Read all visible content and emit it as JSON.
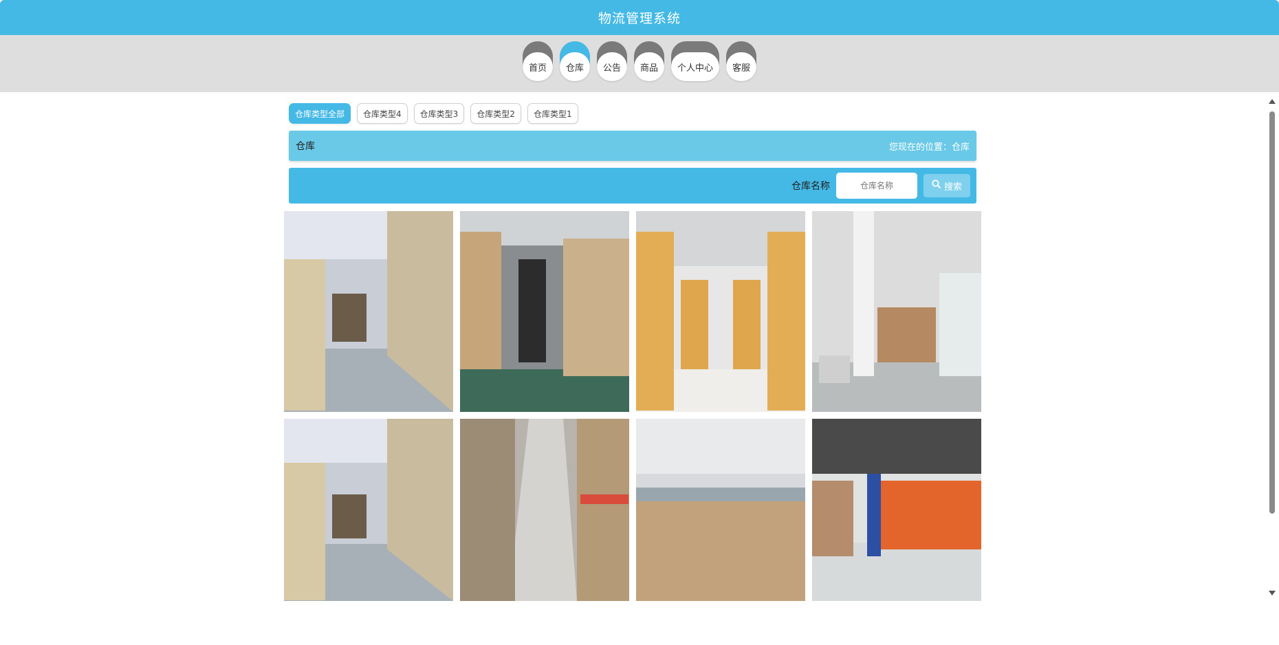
{
  "app": {
    "title": "物流管理系统"
  },
  "nav": {
    "items": [
      {
        "label": "首页",
        "active": false
      },
      {
        "label": "仓库",
        "active": true
      },
      {
        "label": "公告",
        "active": false
      },
      {
        "label": "商品",
        "active": false
      },
      {
        "label": "个人中心",
        "active": false
      },
      {
        "label": "客服",
        "active": false
      }
    ]
  },
  "filters": [
    {
      "label": "仓库类型全部",
      "active": true
    },
    {
      "label": "仓库类型4",
      "active": false
    },
    {
      "label": "仓库类型3",
      "active": false
    },
    {
      "label": "仓库类型2",
      "active": false
    },
    {
      "label": "仓库类型1",
      "active": false
    }
  ],
  "breadcrumb": {
    "page_name": "仓库",
    "location": "您现在的位置：仓库"
  },
  "search": {
    "label": "仓库名称",
    "placeholder": "仓库名称",
    "button_label": "搜索",
    "icon": "search-icon"
  },
  "colors": {
    "primary": "#44b9e6",
    "breadcrumb": "#6ac9e6",
    "nav_band": "#dedede",
    "nav_inactive": "#7a7a7a"
  },
  "gallery": {
    "items": [
      {
        "image": "warehouse-photo-1"
      },
      {
        "image": "warehouse-photo-2"
      },
      {
        "image": "warehouse-photo-3"
      },
      {
        "image": "warehouse-photo-4"
      },
      {
        "image": "warehouse-photo-1"
      },
      {
        "image": "warehouse-photo-5"
      },
      {
        "image": "warehouse-photo-6"
      },
      {
        "image": "warehouse-photo-7"
      }
    ]
  }
}
